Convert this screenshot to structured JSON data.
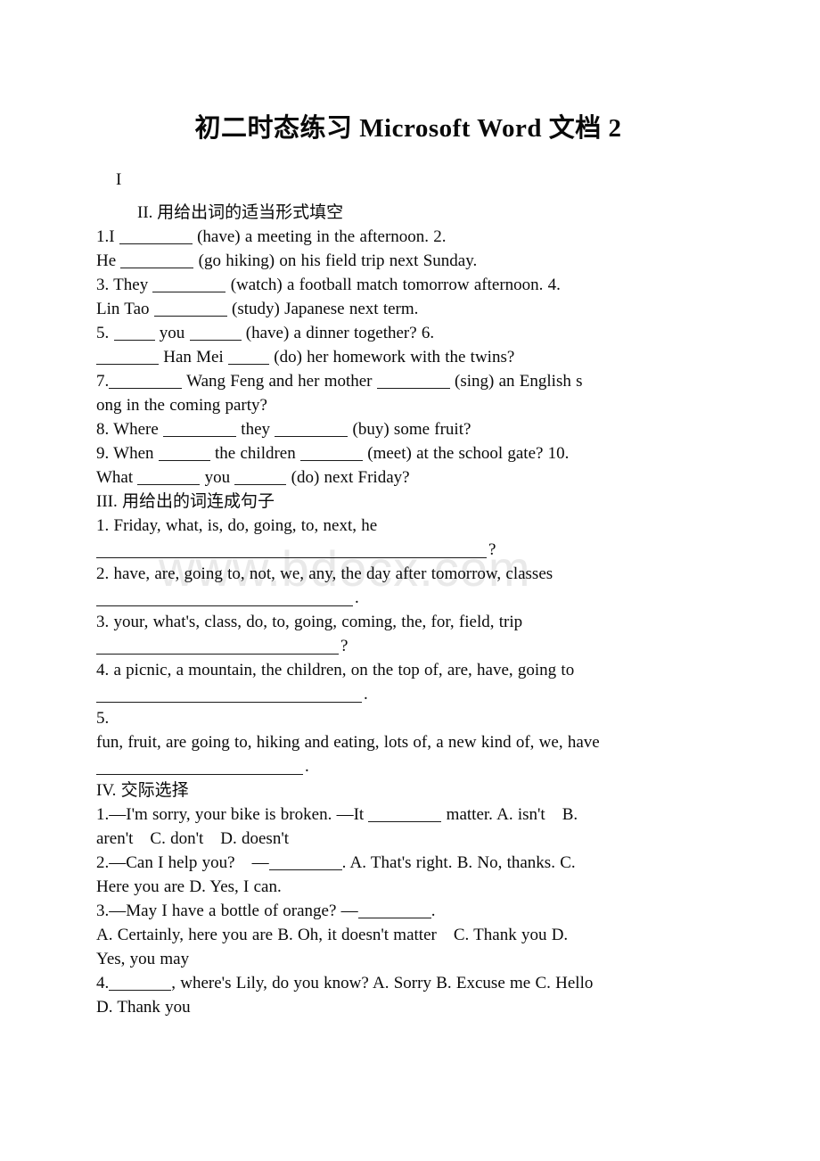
{
  "document": {
    "title": "初二时态练习 Microsoft Word 文档 2",
    "watermark": "www.bdocx.com",
    "section_1_label": "I",
    "sections": [
      {
        "heading": "II. 用给出词的适当形式填空",
        "lines": [
          {
            "pre": "1.I ",
            "blank": 7,
            "post": " (have) a meeting in the afternoon. 2."
          },
          {
            "pre": "He ",
            "blank": 7,
            "post": " (go hiking) on his field trip next Sunday."
          },
          {
            "pre": "3. They ",
            "blank": 7,
            "post": " (watch) a football match tomorrow afternoon. 4."
          },
          {
            "pre": "Lin Tao ",
            "blank": 7,
            "post": " (study) Japanese next term."
          },
          {
            "pre": "5. ",
            "blank": 4,
            "mid": " you ",
            "blank2": 5,
            "post": " (have) a dinner together? 6."
          },
          {
            "pre": "",
            "blank": 6,
            "mid": " Han Mei ",
            "blank2": 4,
            "post": " (do) her homework with the twins?"
          },
          {
            "pre": "7.",
            "blank": 7,
            "mid": " Wang Feng and her mother ",
            "blank2": 7,
            "post": " (sing) an English s"
          },
          {
            "plain": "ong in the coming party?"
          },
          {
            "pre": "8. Where ",
            "blank": 7,
            "mid": " they ",
            "blank2": 7,
            "post": " (buy) some fruit?"
          },
          {
            "pre": "9. When ",
            "blank": 5,
            "mid": " the children ",
            "blank2": 6,
            "post": " (meet) at the school gate? 10."
          },
          {
            "pre": "What ",
            "blank": 6,
            "mid": " you ",
            "blank2": 5,
            "post": " (do) next Friday?"
          }
        ]
      },
      {
        "heading": "III. 用给出的词连成句子",
        "items": [
          {
            "prompt": "1. Friday, what, is, do, going, to, next, he",
            "answer_end": "?"
          },
          {
            "prompt": "2. have, are, going to, not, we, any, the day after tomorrow, classes",
            "answer_end": "."
          },
          {
            "prompt": "3. your, what's, class, do, to, going, coming, the, for, field, trip",
            "answer_end": "?"
          },
          {
            "prompt": "4. a picnic, a mountain, the children, on the top of, are, have, going to",
            "answer_end": "."
          },
          {
            "prompt": "5.",
            "prompt_wrap": "fun, fruit, are going to, hiking and eating, lots of, a new kind of, we, have",
            "answer_end": "."
          }
        ]
      },
      {
        "heading": "IV. 交际选择",
        "questions": [
          {
            "stem_pre": "1.—I'm sorry, your bike is broken. —It ",
            "stem_blank": 7,
            "stem_post": " matter.  A. isn't　B.",
            "options_line": "aren't　C. don't　D. doesn't"
          },
          {
            "stem_pre": "2.—Can I help you?　—",
            "stem_blank": 7,
            "stem_post": ".  A. That's right.  B. No, thanks. C.",
            "options_line": "Here you are  D. Yes, I can."
          },
          {
            "stem_pre": "3.—May I have a bottle of orange? —",
            "stem_blank": 7,
            "stem_post": ".",
            "options_line": " A. Certainly, here you are B. Oh, it doesn't matter　C. Thank you D.",
            "options_line_2": "Yes, you may"
          },
          {
            "stem_pre": "4.",
            "stem_blank": 6,
            "stem_post": ", where's Lily, do you know? A. Sorry B. Excuse me C. Hello",
            "options_line": "D. Thank you"
          }
        ]
      }
    ]
  }
}
